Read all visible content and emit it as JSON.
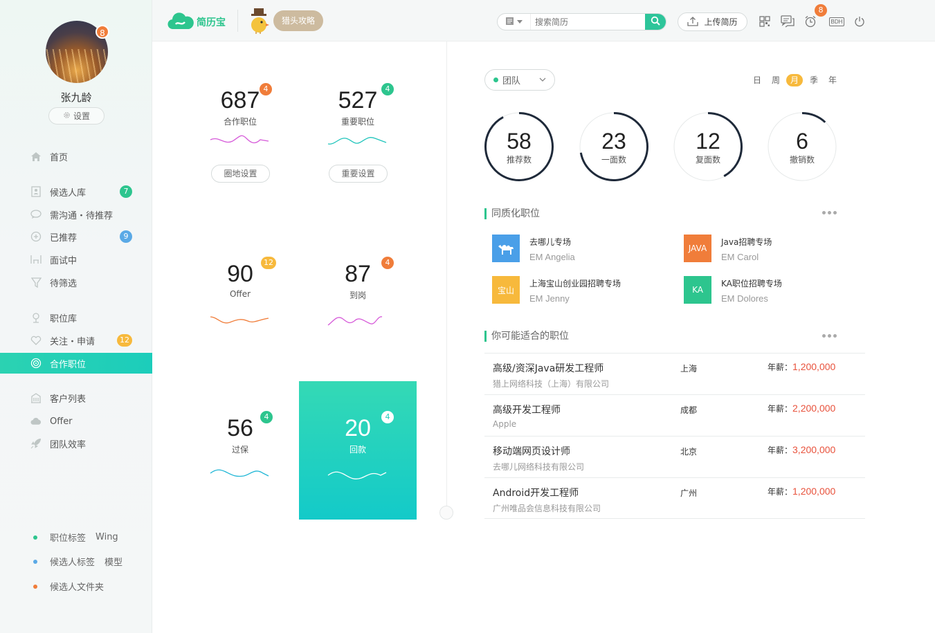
{
  "user": {
    "name": "张九龄",
    "avatar_badge": "8",
    "settings_label": "设置"
  },
  "nav": {
    "home": {
      "label": "首页",
      "icon": "home-icon"
    },
    "candidate_pool": {
      "label": "候选人库",
      "badge": "7",
      "badge_color": "#2dc58e",
      "icon": "contacts-icon"
    },
    "need_contact": {
      "label": "需沟通・待推荐",
      "icon": "chat-icon"
    },
    "recommended": {
      "label": "已推荐",
      "badge": "9",
      "badge_color": "#5aa9e6",
      "icon": "recommend-icon"
    },
    "interviewing": {
      "label": "面试中",
      "icon": "interview-icon"
    },
    "to_filter": {
      "label": "待筛选",
      "icon": "filter-icon"
    },
    "job_pool": {
      "label": "职位库",
      "icon": "briefcase-icon"
    },
    "follow_apply": {
      "label": "关注・申请",
      "badge": "12",
      "badge_color": "#f7b93c",
      "icon": "heart-icon"
    },
    "coop_jobs": {
      "label": "合作职位",
      "icon": "target-icon"
    },
    "client_list": {
      "label": "客户列表",
      "icon": "building-icon"
    },
    "offer": {
      "label": "Offer",
      "icon": "cloud-icon"
    },
    "team_efficiency": {
      "label": "团队效率",
      "icon": "rocket-icon"
    }
  },
  "tags": [
    {
      "label": "职位标签",
      "extra": "Wing",
      "color": "#2dc58e"
    },
    {
      "label": "候选人标签",
      "extra": "模型",
      "color": "#5aa9e6"
    },
    {
      "label": "候选人文件夹",
      "extra": "",
      "color": "#f07d3a"
    }
  ],
  "topbar": {
    "logo_text": "简历宝",
    "hunter_bubble": "猎头攻略",
    "search_placeholder": "搜索简历",
    "upload_label": "上传简历",
    "alarm_badge": "8",
    "user_code": "BDH"
  },
  "stats": [
    {
      "value": "687",
      "label": "合作职位",
      "badge": "4",
      "badge_color": "#f07d3a",
      "wave_color": "#d65ad9",
      "button": "圈地设置"
    },
    {
      "value": "527",
      "label": "重要职位",
      "badge": "4",
      "badge_color": "#2dc58e",
      "wave_color": "#1fc4bb",
      "button": "重要设置"
    },
    {
      "value": "90",
      "label": "Offer",
      "badge": "12",
      "badge_color": "#f7b93c",
      "wave_color": "#f07d3a"
    },
    {
      "value": "87",
      "label": "到岗",
      "badge": "4",
      "badge_color": "#f07d3a",
      "wave_color": "#d65ad9"
    },
    {
      "value": "56",
      "label": "过保",
      "badge": "4",
      "badge_color": "#2dc58e",
      "wave_color": "#1fb6d6"
    },
    {
      "value": "20",
      "label": "回款",
      "badge": "4",
      "badge_color": "#ffffff",
      "wave_color": "#ffffff"
    }
  ],
  "team_select": {
    "label": "团队"
  },
  "periods": [
    {
      "label": "日",
      "active": false
    },
    {
      "label": "周",
      "active": false
    },
    {
      "label": "月",
      "active": true
    },
    {
      "label": "季",
      "active": false
    },
    {
      "label": "年",
      "active": false
    }
  ],
  "rings": [
    {
      "value": "58",
      "label": "推荐数",
      "progress": 0.92
    },
    {
      "value": "23",
      "label": "一面数",
      "progress": 0.72
    },
    {
      "value": "12",
      "label": "复面数",
      "progress": 0.42
    },
    {
      "value": "6",
      "label": "撤销数",
      "progress": 0.12
    }
  ],
  "homogeneous": {
    "title": "同质化职位",
    "items": [
      {
        "name": "去哪儿专场",
        "owner": "EM Angelia",
        "logo_text": "",
        "logo_color": "#4a9fe8",
        "icon": "camel-icon"
      },
      {
        "name": "Java招聘专场",
        "owner": "EM Carol",
        "logo_text": "JAVA",
        "logo_color": "#f07d3a"
      },
      {
        "name": "上海宝山创业园招聘专场",
        "owner": "EM Jenny",
        "logo_text": "宝山",
        "logo_color": "#f7b93c"
      },
      {
        "name": "KA职位招聘专场",
        "owner": "EM Dolores",
        "logo_text": "KA",
        "logo_color": "#2dc58e"
      }
    ]
  },
  "suggested": {
    "title": "你可能适合的职位",
    "salary_label": "年薪：",
    "jobs": [
      {
        "title": "高级/资深Java研发工程师",
        "company": "猎上网络科技（上海）有限公司",
        "city": "上海",
        "salary": "1,200,000"
      },
      {
        "title": "高级开发工程师",
        "company": "Apple",
        "city": "成都",
        "salary": "2,200,000"
      },
      {
        "title": "移动端网页设计师",
        "company": "去哪儿网络科技有限公司",
        "city": "北京",
        "salary": "3,200,000"
      },
      {
        "title": "Android开发工程师",
        "company": "广州唯品会信息科技有限公司",
        "city": "广州",
        "salary": "1,200,000"
      }
    ]
  },
  "colors": {
    "accent": "#2dc58e",
    "teal": "#1ccdbb",
    "salary": "#e8523c"
  }
}
